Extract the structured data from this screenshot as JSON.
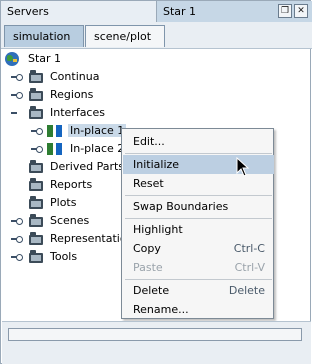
{
  "tabs": {
    "servers": "Servers",
    "star": "Star 1"
  },
  "window_buttons": [
    "restore-icon",
    "close-icon"
  ],
  "subtabs": [
    "simulation",
    "scene/plot"
  ],
  "tree": {
    "root": "Star 1",
    "items": [
      "Continua",
      "Regions",
      "Interfaces",
      "In-place 1",
      "In-place 2",
      "Derived Parts",
      "Reports",
      "Plots",
      "Scenes",
      "Representations",
      "Tools"
    ]
  },
  "menu": {
    "items": [
      {
        "label": "Edit...",
        "shortcut": ""
      },
      {
        "label": "Initialize",
        "shortcut": ""
      },
      {
        "label": "Reset",
        "shortcut": ""
      },
      {
        "label": "Swap Boundaries",
        "shortcut": ""
      },
      {
        "label": "Highlight",
        "shortcut": ""
      },
      {
        "label": "Copy",
        "shortcut": "Ctrl-C"
      },
      {
        "label": "Paste",
        "shortcut": "Ctrl-V"
      },
      {
        "label": "Delete",
        "shortcut": "Delete"
      },
      {
        "label": "Rename...",
        "shortcut": ""
      }
    ]
  },
  "colors": {
    "accent": "#bccfe2",
    "selection": "#c9d9e8",
    "header": "#c6d7e6"
  }
}
